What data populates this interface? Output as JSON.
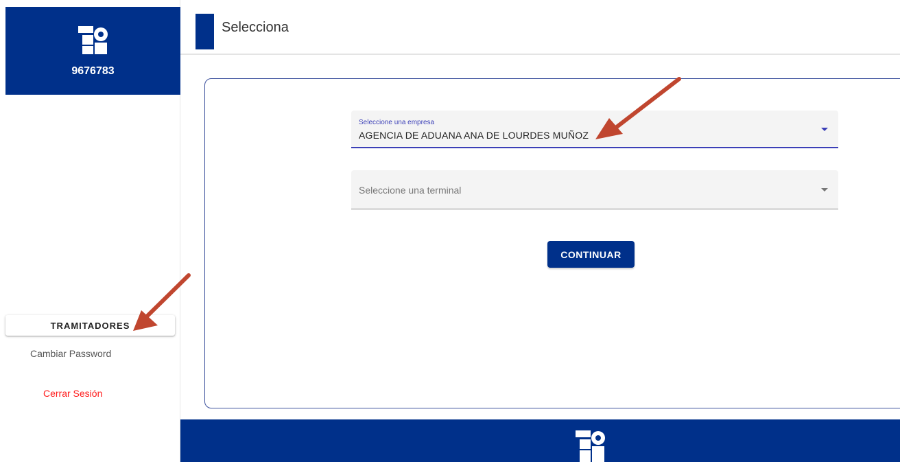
{
  "sidebar": {
    "user_id": "9676783",
    "menu_button": "TRAMITADORES",
    "change_password": "Cambiar Password",
    "logout": "Cerrar Sesión"
  },
  "header": {
    "title": "Selecciona"
  },
  "form": {
    "company": {
      "label": "Seleccione una empresa",
      "value": "AGENCIA DE ADUANA ANA DE LOURDES MUÑOZ"
    },
    "terminal": {
      "placeholder": "Seleccione una terminal"
    },
    "continue_label": "CONTINUAR"
  },
  "colors": {
    "brand": "#00308a",
    "accent": "#3b3fb7",
    "logout": "#ff1a1a",
    "annotation_arrow": "#c0462f"
  },
  "icons": {
    "logo": "tp-logo-icon",
    "dropdown": "caret-down-icon",
    "annotation": "arrow-annotation-icon"
  }
}
